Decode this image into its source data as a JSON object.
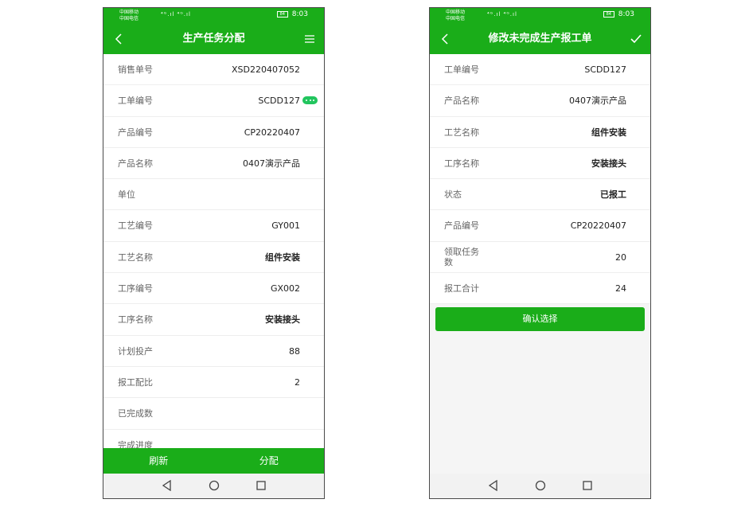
{
  "status_bar": {
    "carrier1": "中国移动",
    "carrier2": "中国电信",
    "signal": "⁴ᴳ.ıl ⁴ᴳ.ıl",
    "battery": "84",
    "time": "8:03"
  },
  "left": {
    "title": "生产任务分配",
    "rows": [
      {
        "label": "销售单号",
        "value": "XSD220407052"
      },
      {
        "label": "工单编号",
        "value": "SCDD127"
      },
      {
        "label": "产品编号",
        "value": "CP20220407"
      },
      {
        "label": "产品名称",
        "value": "0407演示产品"
      },
      {
        "label": "单位",
        "value": ""
      },
      {
        "label": "工艺编号",
        "value": "GY001"
      },
      {
        "label": "工艺名称",
        "value": "组件安装"
      },
      {
        "label": "工序编号",
        "value": "GX002"
      },
      {
        "label": "工序名称",
        "value": "安装接头"
      },
      {
        "label": "计划投产",
        "value": "88"
      },
      {
        "label": "报工配比",
        "value": "2"
      },
      {
        "label": "已完成数",
        "value": ""
      },
      {
        "label": "完成进度",
        "value": ""
      }
    ],
    "refresh_label": "刷新",
    "assign_label": "分配"
  },
  "right": {
    "title": "修改未完成生产报工单",
    "rows": [
      {
        "label": "工单编号",
        "value": "SCDD127"
      },
      {
        "label": "产品名称",
        "value": "0407演示产品"
      },
      {
        "label": "工艺名称",
        "value": "组件安装"
      },
      {
        "label": "工序名称",
        "value": "安装接头"
      },
      {
        "label": "状态",
        "value": "已报工"
      },
      {
        "label": "产品编号",
        "value": "CP20220407"
      },
      {
        "label": "领取任务数",
        "value": "20"
      },
      {
        "label": "报工合计",
        "value": "24"
      }
    ],
    "confirm_label": "确认选择"
  },
  "colors": {
    "accent": "#1aad19"
  },
  "icons": [
    "back-icon",
    "menu-icon",
    "check-icon",
    "more-icon",
    "back-triangle-icon",
    "home-circle-icon",
    "recents-square-icon"
  ]
}
